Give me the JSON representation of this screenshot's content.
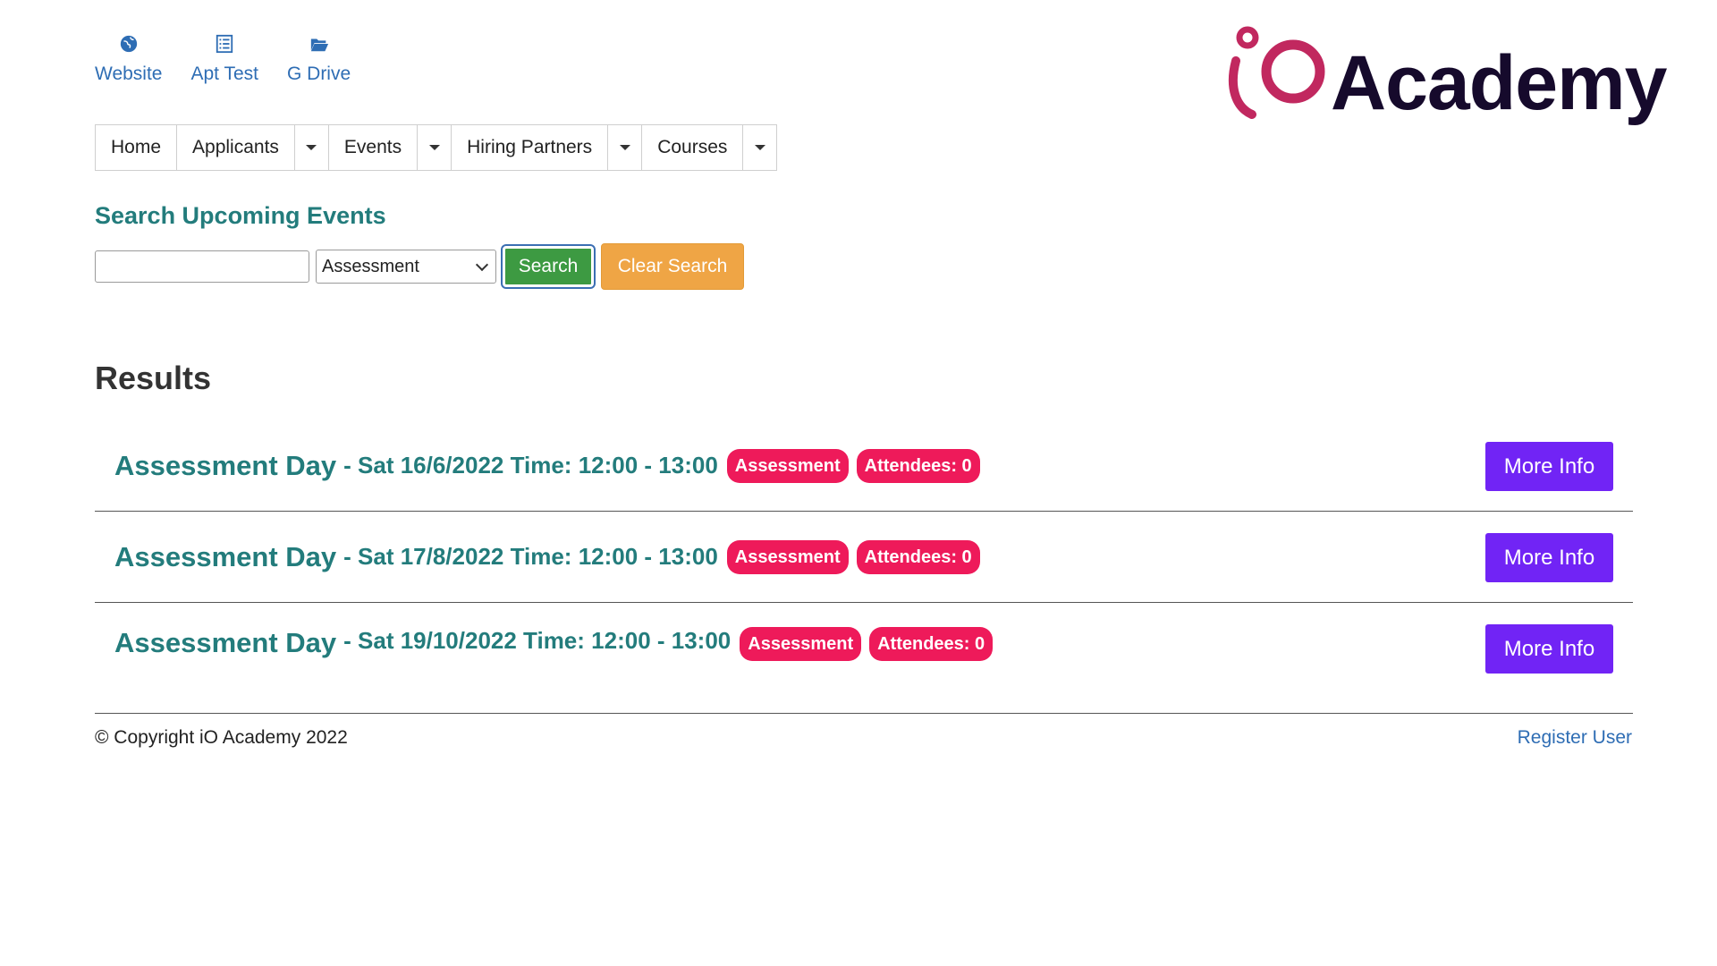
{
  "quick_links": [
    {
      "label": "Website",
      "icon": "globe-icon"
    },
    {
      "label": "Apt Test",
      "icon": "list-icon"
    },
    {
      "label": "G Drive",
      "icon": "folder-open-icon"
    }
  ],
  "logo": {
    "text": "Academy",
    "mark": "iO"
  },
  "nav": {
    "home": "Home",
    "applicants": "Applicants",
    "events": "Events",
    "hiring_partners": "Hiring Partners",
    "courses": "Courses"
  },
  "search": {
    "title": "Search Upcoming Events",
    "input_value": "",
    "select_value": "Assessment",
    "search_label": "Search",
    "clear_label": "Clear Search"
  },
  "results": {
    "title": "Results",
    "items": [
      {
        "name": "Assessment Day",
        "details": "- Sat 16/6/2022 Time: 12:00 - 13:00",
        "type_badge": "Assessment",
        "attendees_badge": "Attendees: 0",
        "button": "More Info"
      },
      {
        "name": "Assessment Day",
        "details": "- Sat 17/8/2022 Time: 12:00 - 13:00",
        "type_badge": "Assessment",
        "attendees_badge": "Attendees: 0",
        "button": "More Info"
      },
      {
        "name": "Assessment Day",
        "details": "- Sat 19/10/2022 Time: 12:00 - 13:00",
        "type_badge": "Assessment",
        "attendees_badge": "Attendees: 0",
        "button": "More Info"
      }
    ]
  },
  "footer": {
    "copyright": "© Copyright iO Academy 2022",
    "register_link": "Register User"
  },
  "colors": {
    "link": "#2e6db4",
    "teal": "#237c7c",
    "search_btn": "#3d9a42",
    "clear_btn": "#efa545",
    "badge": "#ee1a5a",
    "more_info": "#7124f5",
    "logo_pink": "#c1285f",
    "logo_dark": "#160a2c"
  }
}
